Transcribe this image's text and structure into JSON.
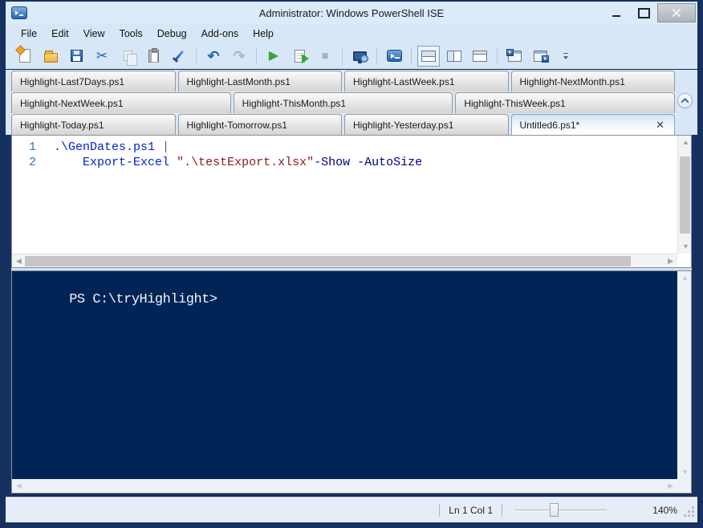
{
  "window": {
    "title": "Administrator: Windows PowerShell ISE"
  },
  "menu": {
    "items": [
      "File",
      "Edit",
      "View",
      "Tools",
      "Debug",
      "Add-ons",
      "Help"
    ]
  },
  "toolbar": {
    "buttons": [
      {
        "name": "new-script",
        "kind": "new"
      },
      {
        "name": "open-script",
        "kind": "open"
      },
      {
        "name": "save-script",
        "kind": "save"
      },
      {
        "name": "cut",
        "kind": "cut",
        "char": "✂"
      },
      {
        "name": "copy",
        "kind": "copy",
        "disabled": true
      },
      {
        "name": "paste",
        "kind": "paste"
      },
      {
        "name": "clear-console-pane",
        "kind": "clear"
      },
      {
        "sep": true
      },
      {
        "name": "undo",
        "kind": "undo",
        "char": "↶"
      },
      {
        "name": "redo",
        "kind": "redo",
        "char": "↷",
        "disabled": true
      },
      {
        "sep": true
      },
      {
        "name": "run-script",
        "kind": "run",
        "char": "▶"
      },
      {
        "name": "run-selection",
        "kind": "runsel"
      },
      {
        "name": "stop-operation",
        "kind": "stop",
        "char": "■",
        "disabled": true
      },
      {
        "sep": true
      },
      {
        "name": "new-remote-powershell-tab",
        "kind": "remote"
      },
      {
        "sep": true
      },
      {
        "name": "start-powershell-exe",
        "kind": "ps"
      },
      {
        "sep": true
      },
      {
        "name": "show-script-pane-top",
        "kind": "pane-top",
        "selected": true
      },
      {
        "name": "show-script-pane-right",
        "kind": "pane-right"
      },
      {
        "name": "show-script-pane-maximized",
        "kind": "pane-max"
      },
      {
        "sep": true
      },
      {
        "name": "new-powershell-tab",
        "kind": "winps1"
      },
      {
        "name": "close-powershell-tab",
        "kind": "winps2"
      },
      {
        "name": "toolbar-overflow",
        "kind": "overflow"
      }
    ]
  },
  "tab_rows": [
    {
      "tabs": [
        {
          "label": "Highlight-Last7Days.ps1"
        },
        {
          "label": "Highlight-LastMonth.ps1"
        },
        {
          "label": "Highlight-LastWeek.ps1"
        },
        {
          "label": "Highlight-NextMonth.ps1"
        }
      ]
    },
    {
      "tabs": [
        {
          "label": "Highlight-NextWeek.ps1"
        },
        {
          "label": "Highlight-ThisMonth.ps1"
        },
        {
          "label": "Highlight-ThisWeek.ps1"
        }
      ]
    },
    {
      "tabs": [
        {
          "label": "Highlight-Today.ps1"
        },
        {
          "label": "Highlight-Tomorrow.ps1"
        },
        {
          "label": "Highlight-Yesterday.ps1"
        },
        {
          "label": "Untitled6.ps1*",
          "active": true,
          "closable": true
        }
      ]
    }
  ],
  "editor": {
    "lines": [
      {
        "number": "1",
        "segments": [
          {
            "text": ".\\GenDates.ps1",
            "type": "command"
          },
          {
            "text": " ",
            "type": "plain"
          },
          {
            "text": "|",
            "type": "operator"
          }
        ]
      },
      {
        "number": "2",
        "segments": [
          {
            "text": "    ",
            "type": "plain"
          },
          {
            "text": "Export-Excel",
            "type": "command"
          },
          {
            "text": " ",
            "type": "plain"
          },
          {
            "text": "\".\\testExport.xlsx\"",
            "type": "string"
          },
          {
            "text": "-Show -AutoSize",
            "type": "parameter"
          }
        ]
      }
    ]
  },
  "console": {
    "prompt": "PS C:\\tryHighlight>"
  },
  "statusbar": {
    "position": "Ln 1 Col 1",
    "zoom_label": "140%"
  },
  "colors": {
    "console_bg": "#012456",
    "console_text": "#f5f5f5",
    "command": "#0026c8",
    "string": "#8b1a1a",
    "parameter": "#000080",
    "operator": "#5a5f66",
    "plain": "#1e1e1e",
    "line_number": "#2f76b5"
  }
}
